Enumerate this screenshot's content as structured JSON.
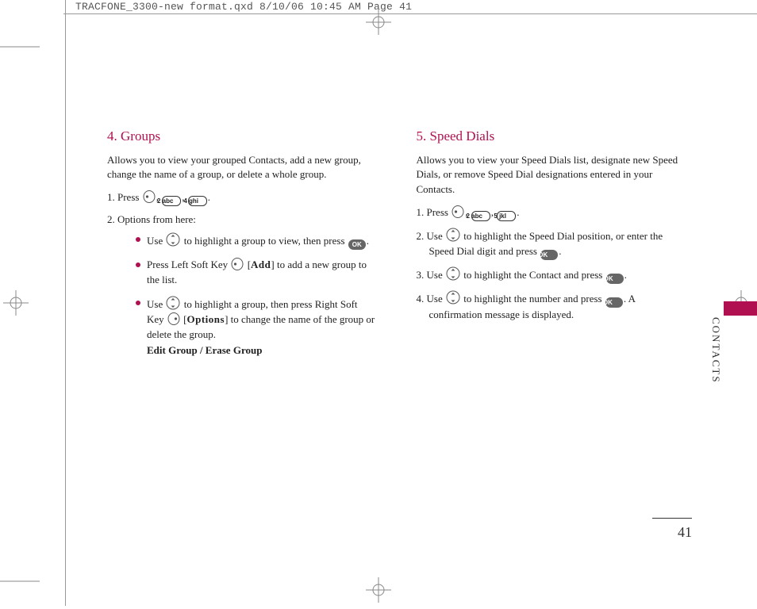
{
  "header": "TRACFONE_3300-new format.qxd  8/10/06  10:45 AM  Page 41",
  "side_label": "CONTACTS",
  "page_number": "41",
  "left": {
    "heading": "4. Groups",
    "intro": "Allows you to view your grouped Contacts, add a new group, change the name of a group, or delete a whole group.",
    "step1_a": "1. Press ",
    "step1_b": ", ",
    "step1_c": ", ",
    "step1_d": ".",
    "key1": "2 abc",
    "key2": "4 ghi",
    "step2": "2. Options from here:",
    "b1_a": "Use ",
    "b1_b": " to highlight a group to view, then press ",
    "b1_c": ".",
    "b2_a": "Press Left Soft Key ",
    "b2_b": " [",
    "b2_label": "Add",
    "b2_c": "] to add a new group to the list.",
    "b3_a": "Use ",
    "b3_b": " to highlight a group, then press Right Soft Key ",
    "b3_c": " [",
    "b3_label": "Options",
    "b3_d": "] to change the name of the group or delete the group.",
    "b3_last": "Edit Group / Erase Group"
  },
  "right": {
    "heading": "5. Speed Dials",
    "intro": "Allows you to view your Speed Dials list, designate new Speed Dials, or remove Speed Dial designations entered in your Contacts.",
    "step1_a": "1. Press ",
    "step1_b": ", ",
    "step1_c": ", ",
    "step1_d": ".",
    "key1": "2 abc",
    "key2": "5 jkl",
    "step2_a": "2. Use ",
    "step2_b": " to highlight the Speed Dial position, or enter the Speed Dial digit and press ",
    "step2_c": ".",
    "step3_a": "3. Use ",
    "step3_b": " to highlight the Contact and press ",
    "step3_c": ".",
    "step4_a": "4. Use ",
    "step4_b": " to highlight the number and press ",
    "step4_c": ". A confirmation message is displayed."
  }
}
